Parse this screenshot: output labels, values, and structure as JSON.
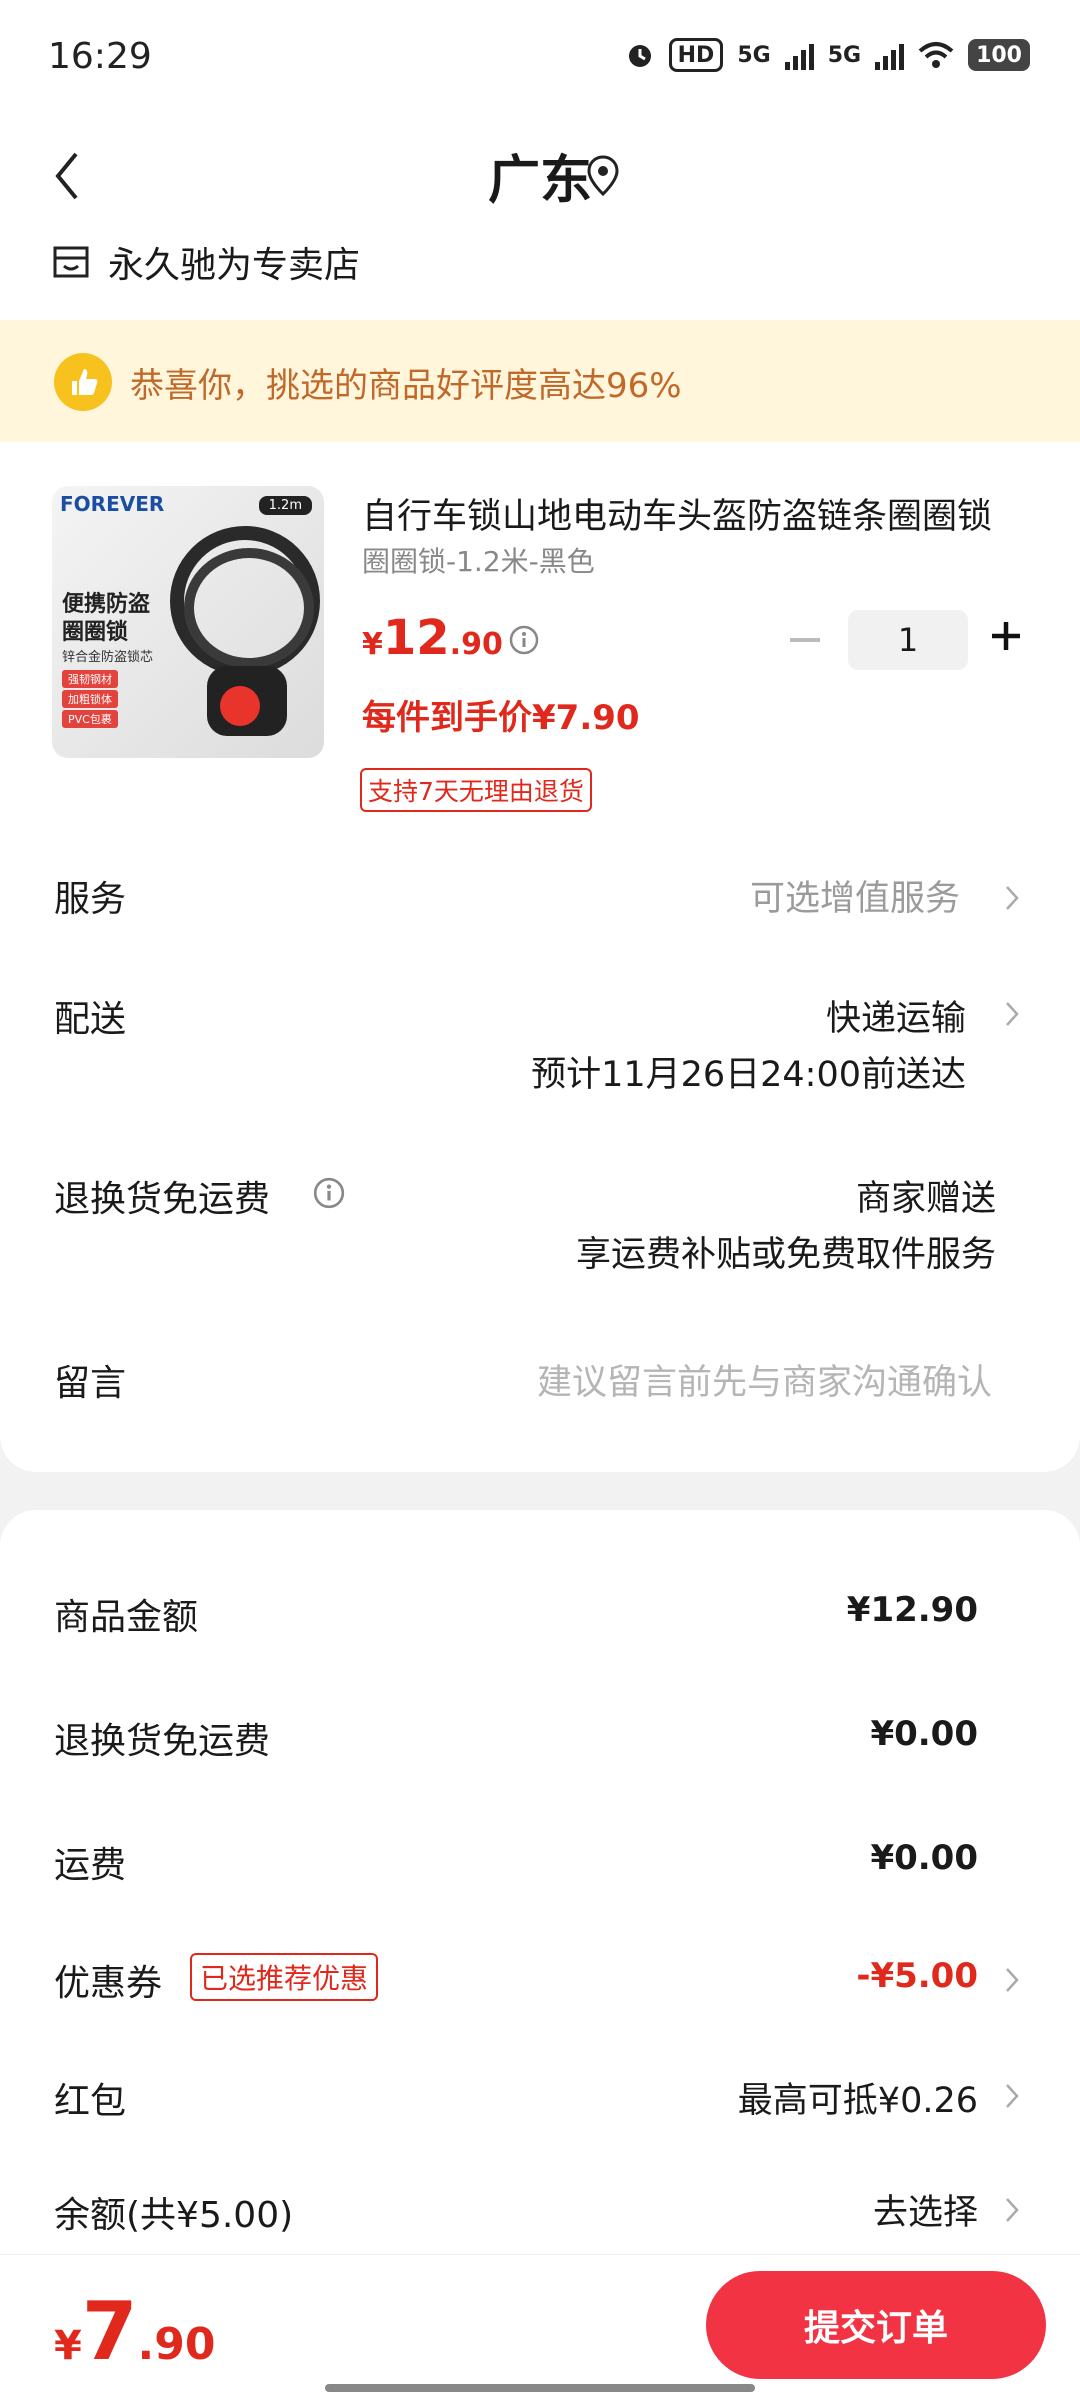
{
  "status": {
    "time": "16:29",
    "hd": "HD",
    "net1": "5G",
    "net2": "5G",
    "battery": "100"
  },
  "header": {
    "region": "广东",
    "store": "永久驰为专卖店"
  },
  "banner": {
    "text": "恭喜你，挑选的商品好评度高达96%"
  },
  "product": {
    "title": "自行车锁山地电动车头盔防盗链条圈圈锁",
    "spec": "圈圈锁-1.2米-黑色",
    "price_currency": "¥",
    "price_int": "12",
    "price_dec": ".90",
    "deal_price": "每件到手价¥7.90",
    "quantity": "1",
    "return_badge": "支持7天无理由退货",
    "image": {
      "brand": "FOREVER",
      "length_tag": "1.2m",
      "line1": "便携防盗",
      "line2": "圈圈锁",
      "line3": "锌合金防盗锁芯",
      "features": [
        "强韧钢材",
        "加粗锁体",
        "PVC包裹"
      ]
    }
  },
  "rows": {
    "service": {
      "label": "服务",
      "value": "可选增值服务"
    },
    "delivery": {
      "label": "配送",
      "value": "快递运输",
      "eta": "预计11月26日24:00前送达"
    },
    "return_shipping": {
      "label": "退换货免运费",
      "value": "商家赠送",
      "sub": "享运费补贴或免费取件服务"
    },
    "message": {
      "label": "留言",
      "placeholder": "建议留言前先与商家沟通确认"
    }
  },
  "summary": {
    "goods": {
      "label": "商品金额",
      "value": "¥12.90"
    },
    "return_fee": {
      "label": "退换货免运费",
      "value": "¥0.00"
    },
    "shipping": {
      "label": "运费",
      "value": "¥0.00"
    },
    "coupon": {
      "label": "优惠券",
      "tag": "已选推荐优惠",
      "value": "-¥5.00"
    },
    "redpacket": {
      "label": "红包",
      "value": "最高可抵¥0.26"
    },
    "balance": {
      "label": "余额(共¥5.00)",
      "value": "去选择"
    }
  },
  "bottom": {
    "currency": "¥",
    "int": "7",
    "dec": ".90",
    "submit": "提交订单"
  },
  "colors": {
    "accent": "#e0291c",
    "button": "#f23344",
    "banner_bg": "#fff6db",
    "banner_text": "#c1692b"
  }
}
